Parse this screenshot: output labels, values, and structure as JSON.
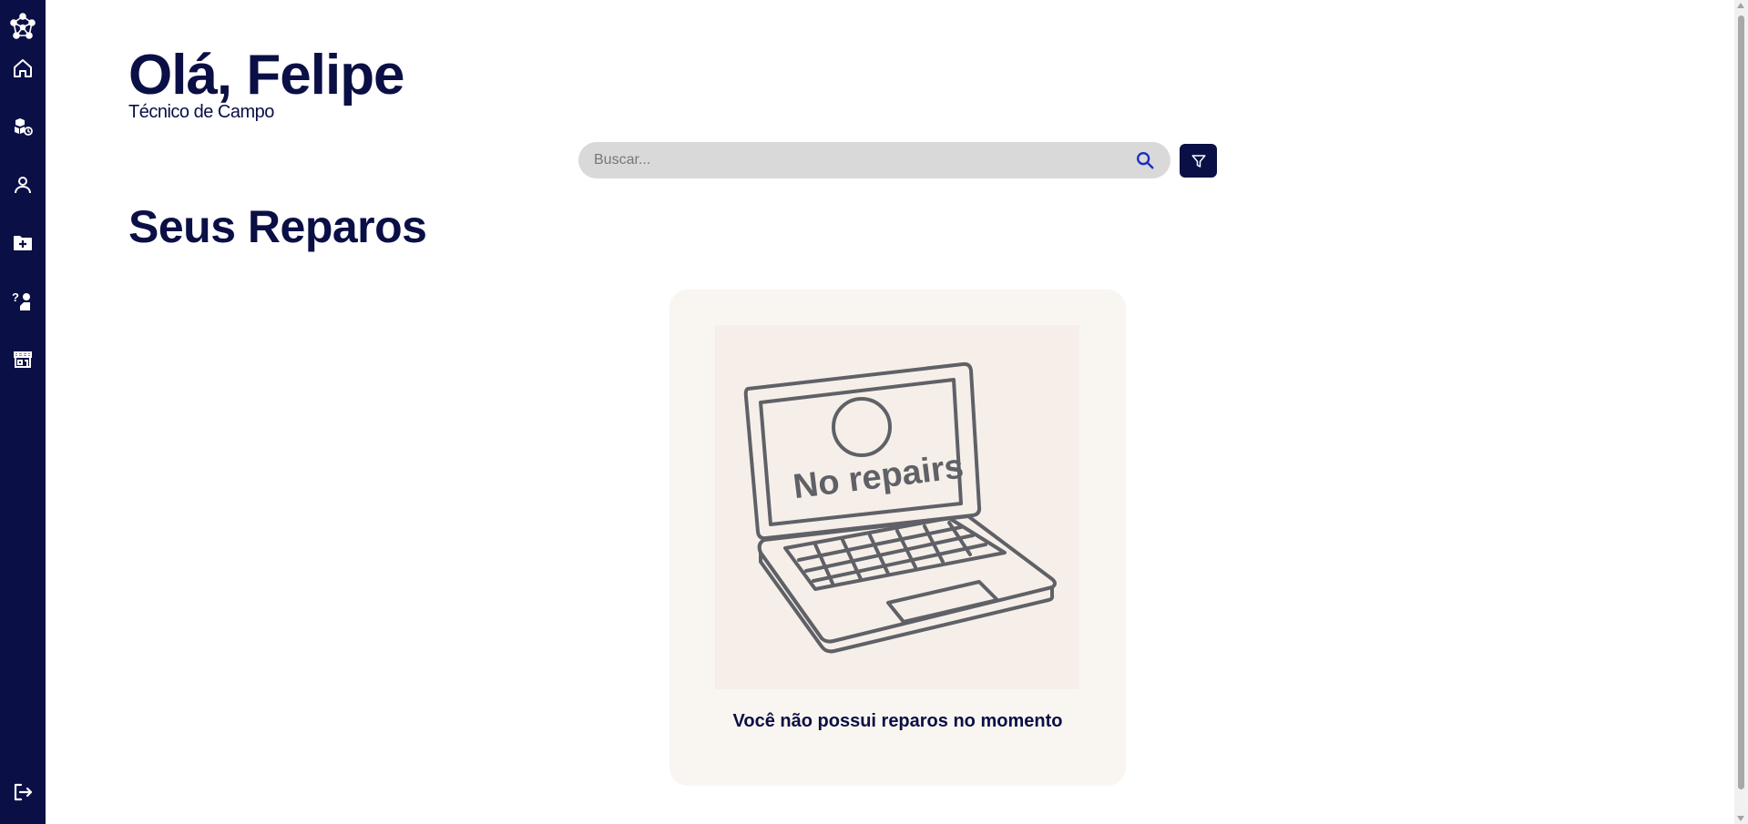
{
  "sidebar": {
    "logo_icon": "network-logo-icon",
    "items": [
      {
        "icon": "home-icon",
        "label": "Home"
      },
      {
        "icon": "boxes-icon",
        "label": "Inventory"
      },
      {
        "icon": "user-icon",
        "label": "Profile"
      },
      {
        "icon": "folder-plus-icon",
        "label": "New"
      },
      {
        "icon": "support-icon",
        "label": "Support"
      },
      {
        "icon": "store-icon",
        "label": "Store"
      }
    ],
    "logout_icon": "logout-icon"
  },
  "header": {
    "greeting": "Olá, Felipe",
    "role": "Técnico de Campo"
  },
  "search": {
    "placeholder": "Buscar...",
    "value": ""
  },
  "section": {
    "title": "Seus Reparos"
  },
  "empty_state": {
    "illustration_text": "No repairs",
    "message": "Você não possui reparos no momento"
  },
  "colors": {
    "brand": "#0a0f45",
    "search_bg": "#d9d9d9",
    "card_bg": "#f9f5f1",
    "search_icon": "#1c2fbf"
  }
}
